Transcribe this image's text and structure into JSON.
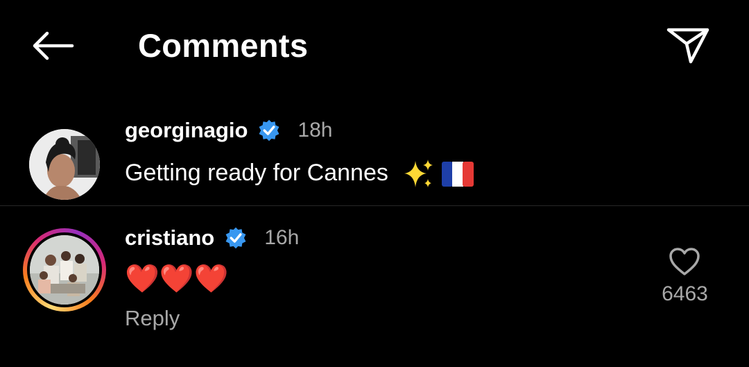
{
  "header": {
    "title": "Comments",
    "back_icon": "arrow-left-icon",
    "send_icon": "paper-plane-icon"
  },
  "caption": {
    "username": "georginagio",
    "verified": true,
    "time": "18h",
    "text": "Getting ready for Cannes",
    "emojis": [
      "sparkles-icon",
      "flag-france-icon"
    ]
  },
  "comment": {
    "username": "cristiano",
    "verified": true,
    "time": "16h",
    "text": "❤️❤️❤️",
    "reply_label": "Reply",
    "like_count": "6463",
    "like_icon": "heart-outline-icon"
  },
  "colors": {
    "background": "#000000",
    "text_primary": "#ffffff",
    "text_secondary": "#a8a8a8",
    "verified_blue": "#3897f0",
    "divider": "#262626",
    "story_ring": [
      "#feda75",
      "#fa7e1e",
      "#d62976",
      "#962fbf"
    ]
  }
}
